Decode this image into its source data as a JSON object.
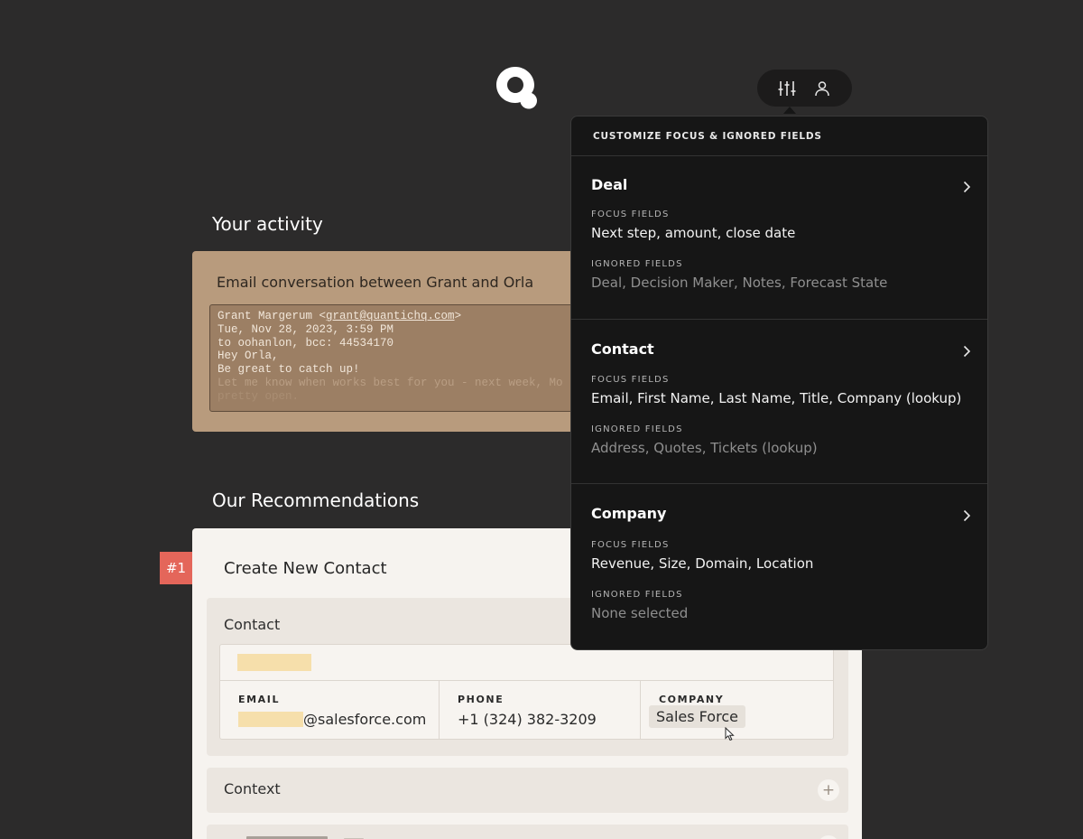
{
  "app": {
    "logo_icon": "q-logo-icon",
    "toolbar": {
      "filter_icon": "sliders-icon",
      "profile_icon": "user-icon"
    }
  },
  "activity": {
    "section_title": "Your activity",
    "card_title": "Email conversation between Grant and Orla",
    "email": {
      "from_name": "Grant Margerum <",
      "from_address": "grant@quantichq.com",
      "from_close": ">",
      "date": "Tue, Nov 28, 2023, 3:59 PM",
      "recipients": "to oohanlon, bcc: 44534170",
      "greeting": "Hey Orla,",
      "line1": "Be great to catch up!",
      "line2": "Let me know when works best for you - next week, Mo",
      "line3": "pretty open."
    }
  },
  "recommendations": {
    "section_title": "Our Recommendations",
    "rank": "#1",
    "card_title": "Create New Contact",
    "contact_panel_label": "Contact",
    "columns": {
      "email_label": "EMAIL",
      "email_domain": "@salesforce.com",
      "phone_label": "PHONE",
      "phone_value": "+1 (324) 382-3209",
      "company_label": "COMPANY",
      "company_value": "Sales Force"
    },
    "context_label": "Context",
    "context_button": "+"
  },
  "popover": {
    "header": "CUSTOMIZE FOCUS & IGNORED FIELDS",
    "focus_label": "FOCUS FIELDS",
    "ignored_label": "IGNORED FIELDS",
    "sections": [
      {
        "name": "Deal",
        "focus": "Next step, amount, close date",
        "ignored": "Deal, Decision Maker, Notes, Forecast State"
      },
      {
        "name": "Contact",
        "focus": "Email, First Name, Last Name, Title, Company (lookup)",
        "ignored": "Address, Quotes, Tickets (lookup)"
      },
      {
        "name": "Company",
        "focus": "Revenue, Size, Domain, Location",
        "ignored": "None selected"
      }
    ]
  },
  "colors": {
    "background": "#2c2b2b",
    "activity_card": "#b89b7d",
    "badge": "#e4665a",
    "popover": "#161616",
    "redaction": "#f6dfab"
  }
}
